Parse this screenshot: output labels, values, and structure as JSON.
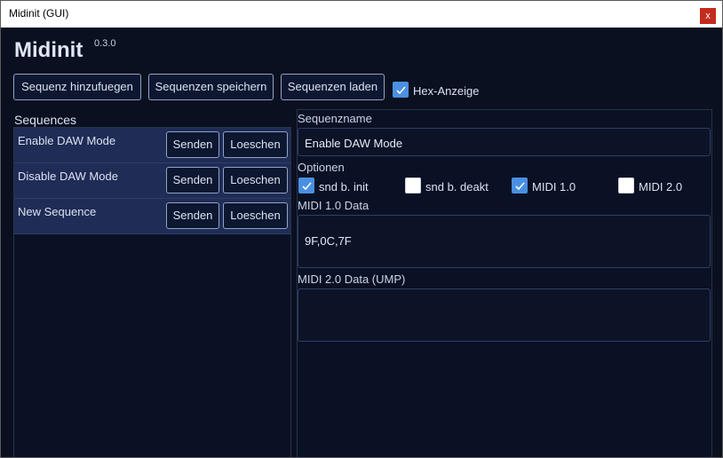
{
  "window": {
    "title": "Midinit (GUI)",
    "close_glyph": "x"
  },
  "app": {
    "name": "Midinit",
    "version": "0.3.0"
  },
  "toolbar": {
    "add_label": "Sequenz hinzufuegen",
    "save_label": "Sequenzen speichern",
    "load_label": "Sequenzen laden",
    "hex_label": "Hex-Anzeige",
    "hex_checked": true
  },
  "sequences": {
    "heading": "Sequences",
    "items": [
      {
        "name": "Enable DAW Mode",
        "send_label": "Senden",
        "delete_label": "Loeschen"
      },
      {
        "name": "Disable DAW Mode",
        "send_label": "Senden",
        "delete_label": "Loeschen"
      },
      {
        "name": "New Sequence",
        "send_label": "Senden",
        "delete_label": "Loeschen"
      }
    ]
  },
  "editor": {
    "name_label": "Sequenzname",
    "name_value": "Enable DAW Mode",
    "options_label": "Optionen",
    "options": [
      {
        "label": "snd b. init",
        "checked": true
      },
      {
        "label": "snd b. deakt",
        "checked": false
      },
      {
        "label": "MIDI 1.0",
        "checked": true
      },
      {
        "label": "MIDI 2.0",
        "checked": false
      }
    ],
    "midi1_label": "MIDI 1.0 Data",
    "midi1_value": "9F,0C,7F",
    "midi2_label": "MIDI 2.0 Data (UMP)",
    "midi2_value": ""
  },
  "colors": {
    "accent": "#4a90e2",
    "background": "#0b1020",
    "row": "#1f2c55"
  }
}
